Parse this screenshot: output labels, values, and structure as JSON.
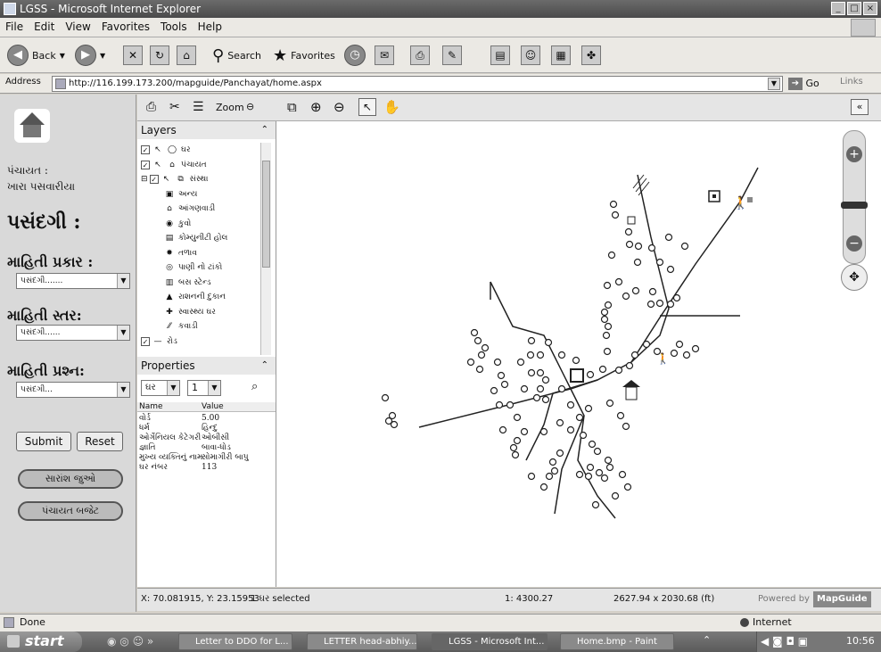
{
  "window": {
    "title": "LGSS - Microsoft Internet Explorer"
  },
  "menu": [
    "File",
    "Edit",
    "View",
    "Favorites",
    "Tools",
    "Help"
  ],
  "toolbar": {
    "back": "Back",
    "search": "Search",
    "favorites": "Favorites"
  },
  "address": {
    "label": "Address",
    "url": "http://116.199.173.200/mapguide/Panchayat/home.aspx",
    "go": "Go",
    "links": "Links"
  },
  "left": {
    "panchayat_label": "પંચાયત :",
    "panchayat_name": "ખારા પસવારીયા",
    "selection_heading": "પસંદગી :",
    "info_type_label": "માહિતી પ્રકાર :",
    "info_type_value": "પસંદગી.......",
    "info_level_label": "માહિતી સ્તર:",
    "info_level_value": "પસંદગી......",
    "info_question_label": "માહિતી પ્રશ્ન:",
    "info_question_value": "પસંદગી...",
    "submit": "Submit",
    "reset": "Reset",
    "link1": "સારાંશ જુઓ",
    "link2": "પંચાયત બજેટ"
  },
  "map_toolbar": {
    "zoom_label": "Zoom"
  },
  "layers": {
    "title": "Layers",
    "items": [
      {
        "label": "ઘર",
        "icon": "circle-icon"
      },
      {
        "label": "પંચાયત",
        "icon": "building-icon"
      },
      {
        "label": "સંસ્થા",
        "icon": "group-icon"
      },
      {
        "label": "અન્ય",
        "icon": "square-dot-icon"
      },
      {
        "label": "આંગણવાડી",
        "icon": "house-icon"
      },
      {
        "label": "કુવો",
        "icon": "well-icon"
      },
      {
        "label": "કોમ્યુનીટી હોલ",
        "icon": "hall-icon"
      },
      {
        "label": "તળાવ",
        "icon": "pond-icon"
      },
      {
        "label": "પાણી નો ટાંકો",
        "icon": "tank-icon"
      },
      {
        "label": "બસ સ્ટેન્ડ",
        "icon": "bus-icon"
      },
      {
        "label": "રાશનની દુકાન",
        "icon": "shop-icon"
      },
      {
        "label": "સ્વાસ્થ્ય ઘર",
        "icon": "health-icon"
      },
      {
        "label": "કવાડી",
        "icon": "hatch-icon"
      },
      {
        "label": "રોડ",
        "icon": "road-icon"
      }
    ]
  },
  "properties": {
    "title": "Properties",
    "layer_select": "ઘર",
    "index_select": "1",
    "col_name": "Name",
    "col_value": "Value",
    "rows": [
      {
        "name": "વોર્ડ",
        "value": "5.00"
      },
      {
        "name": "ધર્મ",
        "value": "હિન્દુ"
      },
      {
        "name": "ઓર્ગેનિયલ કેટેગરી",
        "value": "ઓબીસી"
      },
      {
        "name": "જ્ઞાતિ",
        "value": "બાવા-ધોડ"
      },
      {
        "name": "મુખ્ય વ્યક્તિનું નામ",
        "value": "સોમાગીરી બાપુ"
      },
      {
        "name": "ઘર નંબર",
        "value": "113"
      }
    ]
  },
  "status": {
    "coords": "X: 70.081915, Y: 23.15953",
    "selected": "1 ઘર selected",
    "scale": "1: 4300.27",
    "size": "2627.94 x 2030.68 (ft)",
    "powered_by": "Powered by",
    "brand": "MapGuide"
  },
  "ie_status": {
    "done": "Done",
    "zone": "Internet"
  },
  "taskbar": {
    "start": "start",
    "tasks": [
      "Letter to DDO for L...",
      "LETTER head-abhiy...",
      "LGSS - Microsoft Int...",
      "Home.bmp - Paint"
    ],
    "clock": "10:56"
  }
}
